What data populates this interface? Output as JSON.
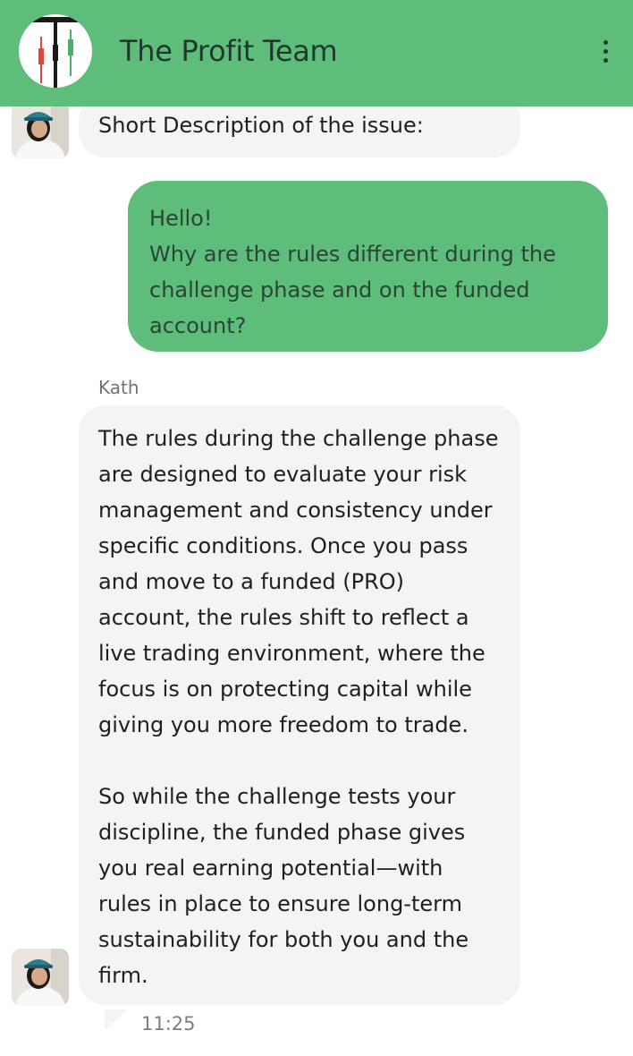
{
  "header": {
    "title": "The Profit Team",
    "logo_icon": "candlestick-logo",
    "menu_icon": "more-vert-icon",
    "background_color": "#5fbd7b"
  },
  "messages": [
    {
      "from": "agent",
      "text": "Short Description of the issue:"
    },
    {
      "from": "user",
      "text": "Hello!\nWhy are the rules different during the challenge phase and on the funded account?"
    },
    {
      "from": "agent",
      "sender": "Kath",
      "text": "The rules during the challenge phase are designed to evaluate your risk management and consistency under specific conditions. Once you pass and move to a funded (PRO) account, the rules shift to reflect a live trading environment, where the focus is on protecting capital while giving you more freedom to trade.\n\nSo while the challenge tests your discipline, the funded phase gives you real earning potential—with rules in place to ensure long-term sustainability for both you and the firm.",
      "time": "11:25"
    }
  ],
  "colors": {
    "user_bubble": "#5fbd7b",
    "agent_bubble": "#f3f4f6"
  }
}
